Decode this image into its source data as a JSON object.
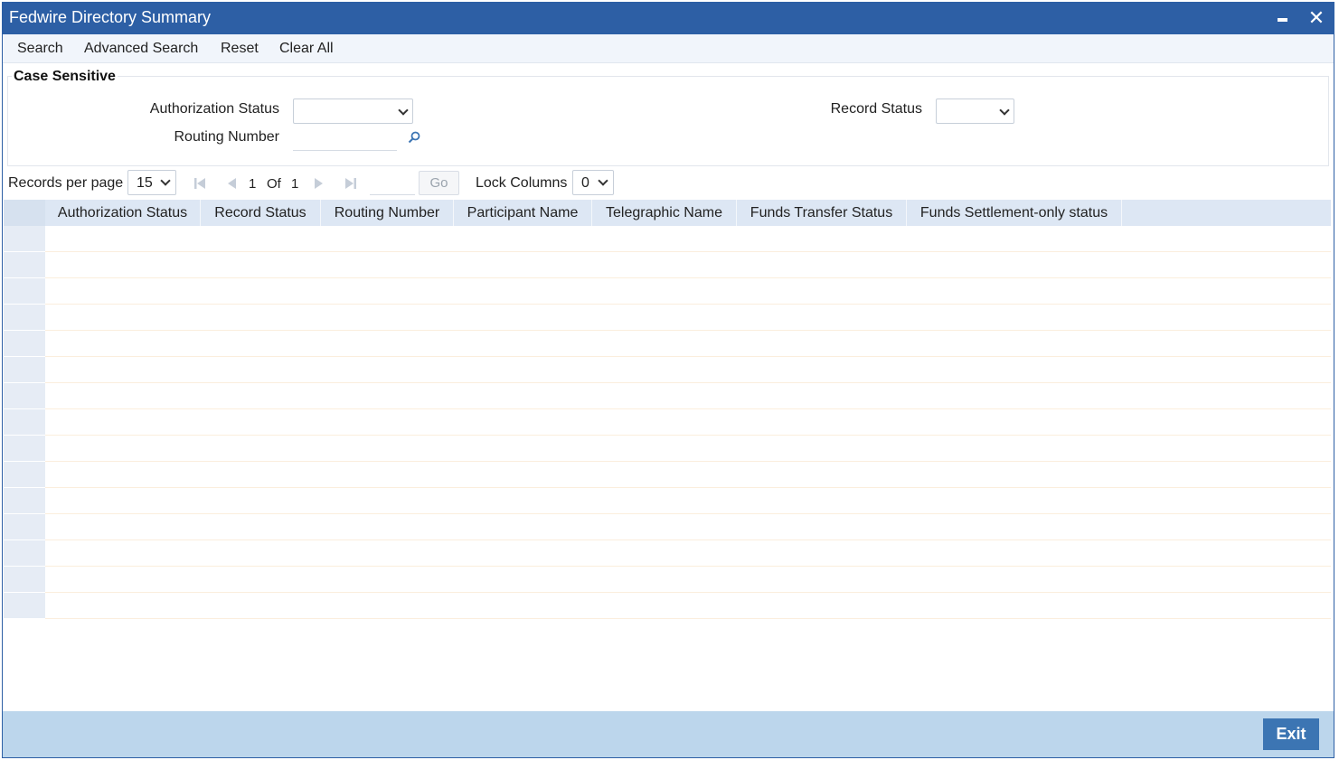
{
  "window": {
    "title": "Fedwire Directory Summary"
  },
  "toolbar": {
    "items": [
      "Search",
      "Advanced Search",
      "Reset",
      "Clear All"
    ]
  },
  "criteria": {
    "legend": "Case Sensitive",
    "authorization_status_label": "Authorization Status",
    "routing_number_label": "Routing Number",
    "record_status_label": "Record Status",
    "authorization_status_value": "",
    "routing_number_value": "",
    "record_status_value": ""
  },
  "pager": {
    "records_per_page_label": "Records per page",
    "records_per_page_value": "15",
    "current_page": "1",
    "of_label": "Of",
    "total_pages": "1",
    "go_label": "Go",
    "lock_columns_label": "Lock Columns",
    "lock_columns_value": "0"
  },
  "grid": {
    "columns": [
      "Authorization Status",
      "Record Status",
      "Routing Number",
      "Participant Name",
      "Telegraphic Name",
      "Funds Transfer Status",
      "Funds Settlement-only status"
    ],
    "rows": 15
  },
  "footer": {
    "exit_label": "Exit"
  },
  "colors": {
    "titlebar": "#2d5fa5",
    "header": "#dde7f4",
    "footer": "#bcd6ec",
    "exit_button": "#3c75b3"
  },
  "icons": [
    "minimize-icon",
    "close-icon",
    "chevron-down-icon",
    "search-lookup-icon",
    "first-page-icon",
    "previous-page-icon",
    "next-page-icon",
    "last-page-icon"
  ]
}
